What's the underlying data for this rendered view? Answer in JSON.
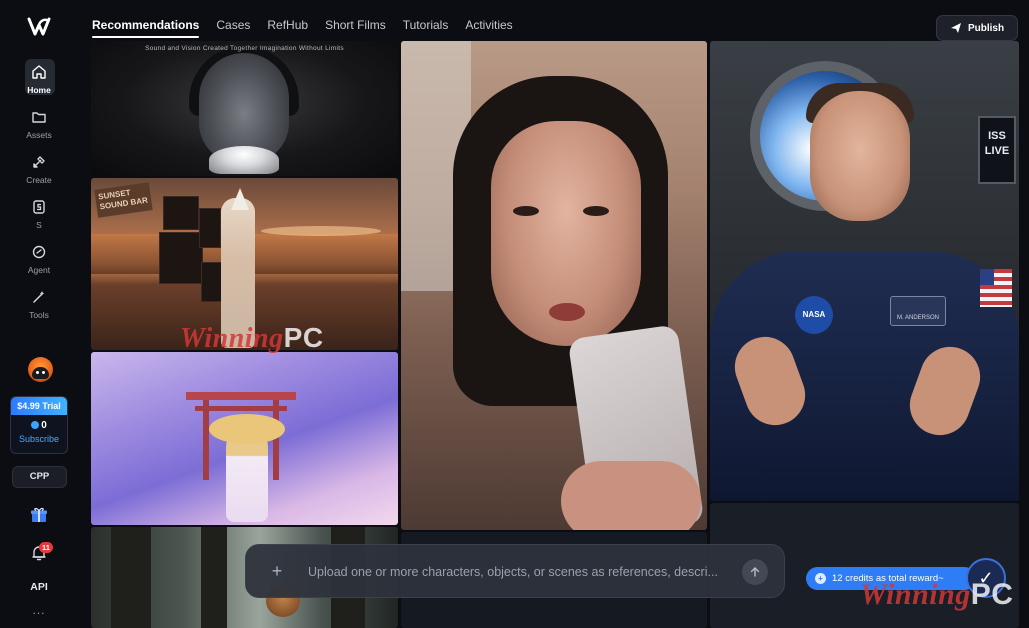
{
  "sidebar": {
    "items": [
      {
        "label": "Home",
        "icon": "home-icon",
        "active": true
      },
      {
        "label": "Assets",
        "icon": "folder-icon"
      },
      {
        "label": "Create",
        "icon": "create-icon"
      },
      {
        "label": "S",
        "icon": "s-icon"
      },
      {
        "label": "Agent",
        "icon": "agent-icon"
      },
      {
        "label": "Tools",
        "icon": "wand-icon"
      }
    ],
    "trial": {
      "price": "$4.99 Trial",
      "count": "0",
      "subscribe": "Subscribe"
    },
    "cpp_label": "CPP",
    "notifications": "11",
    "api_label": "API",
    "more_label": "..."
  },
  "header": {
    "tabs": [
      {
        "label": "Recommendations",
        "active": true
      },
      {
        "label": "Cases"
      },
      {
        "label": "RefHub"
      },
      {
        "label": "Short Films"
      },
      {
        "label": "Tutorials"
      },
      {
        "label": "Activities"
      }
    ],
    "publish_label": "Publish"
  },
  "gallery": {
    "tile1_tagline": "Sound and Vision Created Together Imagination Without Limits",
    "tile2_sign": "SUNSET SOUND BAR",
    "tile6_sign": "ISS LIVE",
    "tile6_patch": "NASA",
    "tile6_name": "M. ANDERSON",
    "watermark_script": "Winning",
    "watermark_pc": "PC"
  },
  "prompt": {
    "placeholder": "Upload one or more characters, objects, or scenes as references, descri..."
  },
  "credits": {
    "label": "12 credits as total reward~"
  },
  "colors": {
    "accent": "#2f7df6",
    "badge": "#e5383b",
    "background": "#0b0d12"
  }
}
